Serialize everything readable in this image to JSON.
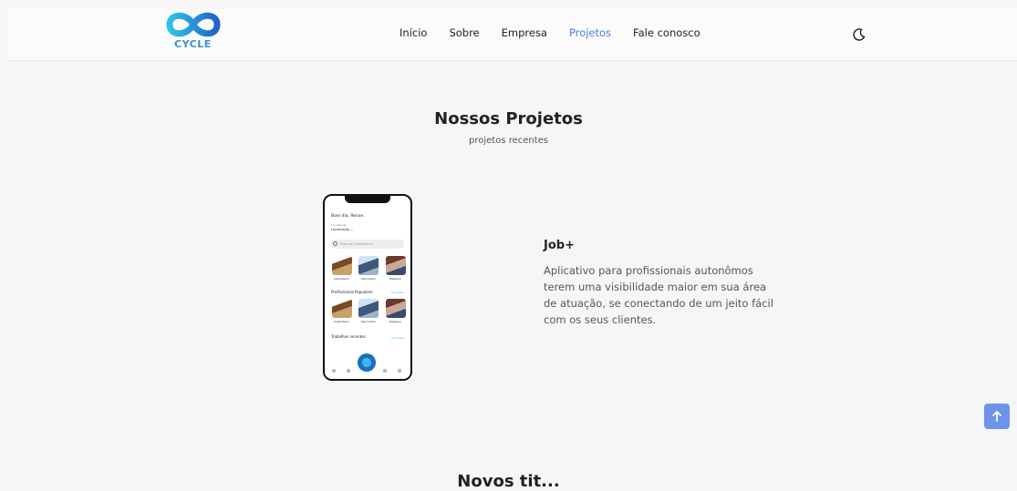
{
  "header": {
    "logo_text": "CYCLE",
    "nav": [
      {
        "label": "Início",
        "active": false
      },
      {
        "label": "Sobre",
        "active": false
      },
      {
        "label": "Empresa",
        "active": false
      },
      {
        "label": "Projetos",
        "active": true
      },
      {
        "label": "Fale conosco",
        "active": false
      }
    ],
    "theme_icon": "moon-icon",
    "accent_color": "#4a7ce0"
  },
  "section": {
    "title": "Nossos Projetos",
    "subtitle": "projetos recentes"
  },
  "project": {
    "title": "Job+",
    "description": "Aplicativo para profissionais autonômos terem uma visibilidade maior em sua área de atuação, se conectando de um jeito fácil com os seus clientes.",
    "phone": {
      "greeting": "Bom dia, Renan",
      "location_label": "Localização",
      "location": "Localização ⌄",
      "search_placeholder": "Procurar Profissional",
      "categories": [
        "Carpinteiro",
        "Decorador",
        "Designer"
      ],
      "popular_title": "Profissionais Populares",
      "popular": [
        "Carpinteiro",
        "Decorador",
        "Designer"
      ],
      "see_all": "ver todos",
      "recent_title": "Trabalhos recentes",
      "recent_see_all": "ver todos"
    }
  },
  "scroll_top_icon": "arrow-up-icon",
  "next_section_title": "Novos tit..."
}
